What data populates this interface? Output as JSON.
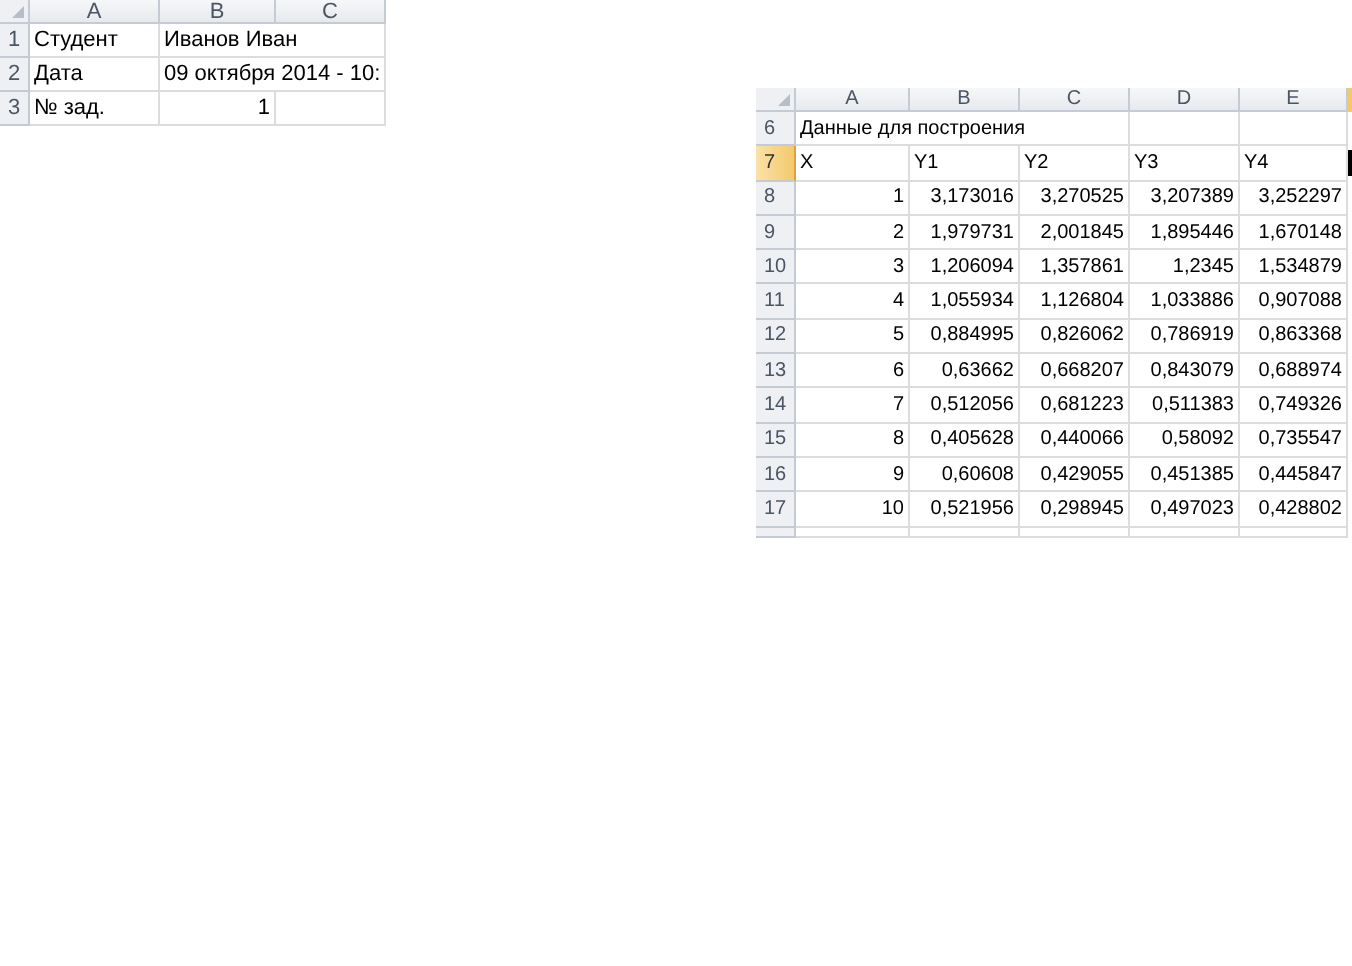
{
  "sheets": [
    {
      "columns": [
        {
          "label": "A",
          "selected": false
        },
        {
          "label": "B",
          "selected": false
        },
        {
          "label": "C",
          "selected": false
        }
      ],
      "rows": [
        {
          "number": "1",
          "selected": false,
          "cells": [
            {
              "text": "Студент",
              "kind": "text"
            },
            {
              "text": "Иванов Иван",
              "kind": "text"
            },
            null
          ]
        },
        {
          "number": "2",
          "selected": false,
          "cells": [
            {
              "text": "Дата",
              "kind": "text"
            },
            {
              "text": "09 октября 2014 - 10:",
              "kind": "text"
            },
            null
          ]
        },
        {
          "number": "3",
          "selected": false,
          "cells": [
            {
              "text": "№ зад.",
              "kind": "text"
            },
            {
              "text": "1",
              "kind": "number"
            },
            null
          ]
        }
      ]
    },
    {
      "columns": [
        {
          "label": "A",
          "selected": false
        },
        {
          "label": "B",
          "selected": false
        },
        {
          "label": "C",
          "selected": false
        },
        {
          "label": "D",
          "selected": false
        },
        {
          "label": "E",
          "selected": false
        }
      ],
      "cut_column": {
        "selected": true
      },
      "rows": [
        {
          "number": "6",
          "selected": false,
          "cells": [
            {
              "text": "Данные для построения",
              "kind": "text"
            },
            null,
            null,
            null,
            null
          ]
        },
        {
          "number": "7",
          "selected": true,
          "cells": [
            {
              "text": "X",
              "kind": "text"
            },
            {
              "text": "Y1",
              "kind": "text"
            },
            {
              "text": "Y2",
              "kind": "text"
            },
            {
              "text": "Y3",
              "kind": "text"
            },
            {
              "text": "Y4",
              "kind": "text"
            }
          ]
        },
        {
          "number": "8",
          "selected": false,
          "cells": [
            {
              "text": "1",
              "kind": "number"
            },
            {
              "text": "3,173016",
              "kind": "number"
            },
            {
              "text": "3,270525",
              "kind": "number"
            },
            {
              "text": "3,207389",
              "kind": "number"
            },
            {
              "text": "3,252297",
              "kind": "number"
            }
          ]
        },
        {
          "number": "9",
          "selected": false,
          "cells": [
            {
              "text": "2",
              "kind": "number"
            },
            {
              "text": "1,979731",
              "kind": "number"
            },
            {
              "text": "2,001845",
              "kind": "number"
            },
            {
              "text": "1,895446",
              "kind": "number"
            },
            {
              "text": "1,670148",
              "kind": "number"
            }
          ]
        },
        {
          "number": "10",
          "selected": false,
          "cells": [
            {
              "text": "3",
              "kind": "number"
            },
            {
              "text": "1,206094",
              "kind": "number"
            },
            {
              "text": "1,357861",
              "kind": "number"
            },
            {
              "text": "1,2345",
              "kind": "number"
            },
            {
              "text": "1,534879",
              "kind": "number"
            }
          ]
        },
        {
          "number": "11",
          "selected": false,
          "cells": [
            {
              "text": "4",
              "kind": "number"
            },
            {
              "text": "1,055934",
              "kind": "number"
            },
            {
              "text": "1,126804",
              "kind": "number"
            },
            {
              "text": "1,033886",
              "kind": "number"
            },
            {
              "text": "0,907088",
              "kind": "number"
            }
          ]
        },
        {
          "number": "12",
          "selected": false,
          "cells": [
            {
              "text": "5",
              "kind": "number"
            },
            {
              "text": "0,884995",
              "kind": "number"
            },
            {
              "text": "0,826062",
              "kind": "number"
            },
            {
              "text": "0,786919",
              "kind": "number"
            },
            {
              "text": "0,863368",
              "kind": "number"
            }
          ]
        },
        {
          "number": "13",
          "selected": false,
          "cells": [
            {
              "text": "6",
              "kind": "number"
            },
            {
              "text": "0,63662",
              "kind": "number"
            },
            {
              "text": "0,668207",
              "kind": "number"
            },
            {
              "text": "0,843079",
              "kind": "number"
            },
            {
              "text": "0,688974",
              "kind": "number"
            }
          ]
        },
        {
          "number": "14",
          "selected": false,
          "cells": [
            {
              "text": "7",
              "kind": "number"
            },
            {
              "text": "0,512056",
              "kind": "number"
            },
            {
              "text": "0,681223",
              "kind": "number"
            },
            {
              "text": "0,511383",
              "kind": "number"
            },
            {
              "text": "0,749326",
              "kind": "number"
            }
          ]
        },
        {
          "number": "15",
          "selected": false,
          "cells": [
            {
              "text": "8",
              "kind": "number"
            },
            {
              "text": "0,405628",
              "kind": "number"
            },
            {
              "text": "0,440066",
              "kind": "number"
            },
            {
              "text": "0,58092",
              "kind": "number"
            },
            {
              "text": "0,735547",
              "kind": "number"
            }
          ]
        },
        {
          "number": "16",
          "selected": false,
          "cells": [
            {
              "text": "9",
              "kind": "number"
            },
            {
              "text": "0,60608",
              "kind": "number"
            },
            {
              "text": "0,429055",
              "kind": "number"
            },
            {
              "text": "0,451385",
              "kind": "number"
            },
            {
              "text": "0,445847",
              "kind": "number"
            }
          ]
        },
        {
          "number": "17",
          "selected": false,
          "cells": [
            {
              "text": "10",
              "kind": "number"
            },
            {
              "text": "0,521956",
              "kind": "number"
            },
            {
              "text": "0,298945",
              "kind": "number"
            },
            {
              "text": "0,497023",
              "kind": "number"
            },
            {
              "text": "0,428802",
              "kind": "number"
            }
          ]
        }
      ]
    }
  ]
}
